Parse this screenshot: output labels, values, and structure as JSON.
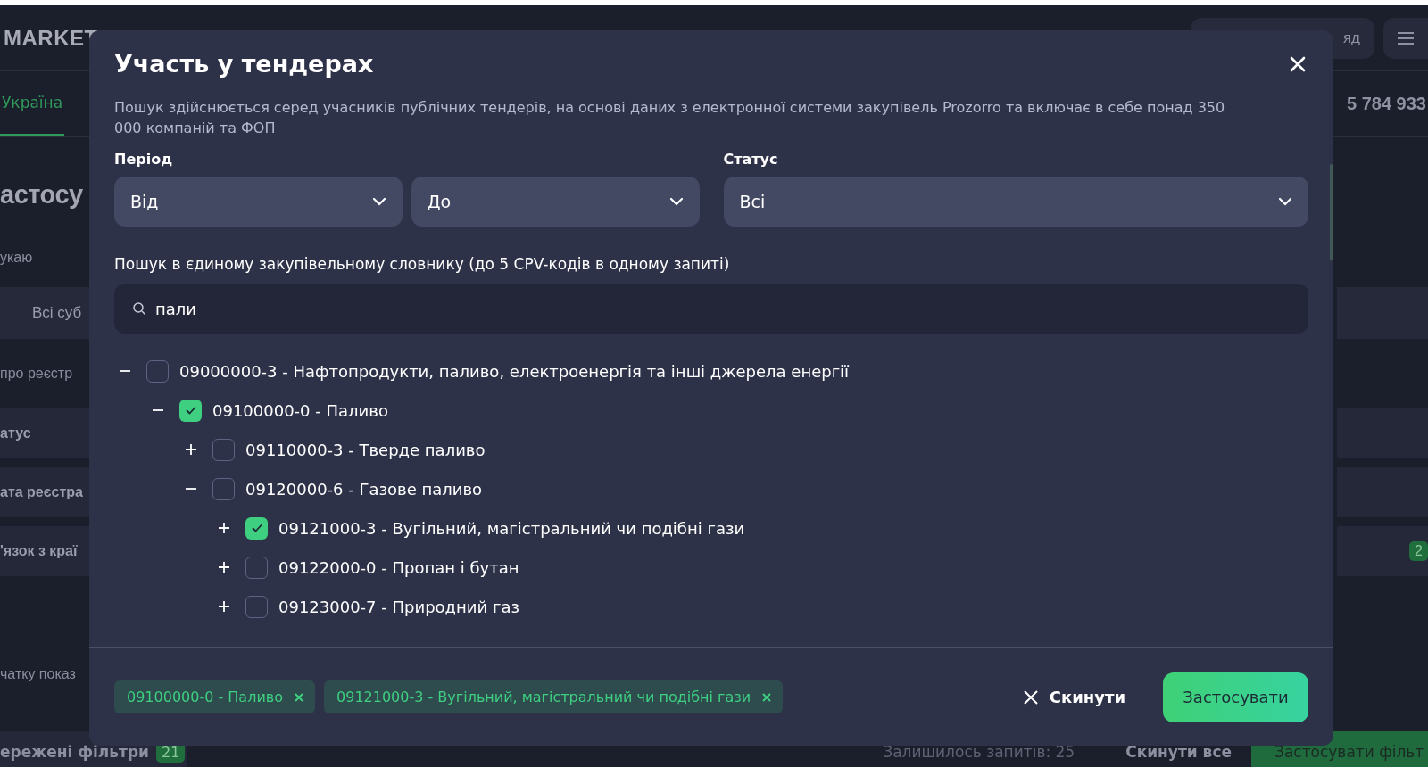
{
  "page": {
    "logo": "MARKET",
    "header_button": "яд",
    "tab": "Україна",
    "counter": "5 784 933",
    "heading": "астосу",
    "text_1": "укаю",
    "select_1": "Всі суб",
    "text_2": "про реєстр",
    "rows": [
      {
        "label": "атус"
      },
      {
        "label": "ата реєстра"
      },
      {
        "label": "'язок з краї",
        "badge": "2"
      }
    ],
    "text_3": "чатку показ",
    "bottom_bar": {
      "saved": "ережені фільтри",
      "saved_count": "21",
      "remaining": "Залишилось запитів: 25",
      "reset_all": "Скинути все",
      "apply": "Застосувати фільт"
    }
  },
  "dialog": {
    "title": "Участь у тендерах",
    "description": "Пошук здійснюється серед учасників публічних тендерів, на основі даних з електронної системи закупівель Prozorro та включає в себе понад 350 000 компаній та ФОП",
    "period": {
      "label": "Період",
      "from": "Від",
      "to": "До"
    },
    "status": {
      "label": "Статус",
      "value": "Всі"
    },
    "search": {
      "label": "Пошук в єдиному закупівельному словнику (до 5 CPV-кодів в одному запиті)",
      "value": "пали"
    },
    "tree": [
      {
        "label": "09000000-3 - Нафтопродукти, паливо, електроенергія та інші джерела енергії",
        "expanded": true,
        "checked": false,
        "children": [
          {
            "label": "09100000-0 - Паливо",
            "expanded": true,
            "checked": true,
            "children": [
              {
                "label": "09110000-3 - Тверде паливо",
                "expanded": false,
                "checked": false
              },
              {
                "label": "09120000-6 - Газове паливо",
                "expanded": true,
                "checked": false,
                "children": [
                  {
                    "label": "09121000-3 - Вугільний, магістральний чи подібні гази",
                    "expanded": false,
                    "checked": true
                  },
                  {
                    "label": "09122000-0 - Пропан і бутан",
                    "expanded": false,
                    "checked": false
                  },
                  {
                    "label": "09123000-7 - Природний газ",
                    "expanded": false,
                    "checked": false
                  }
                ]
              }
            ]
          }
        ]
      }
    ],
    "chips": [
      {
        "label": "09100000-0 - Паливо"
      },
      {
        "label": "09121000-3 - Вугільний, магістральний чи подібні гази"
      }
    ],
    "reset": "Скинути",
    "apply": "Застосувати"
  }
}
